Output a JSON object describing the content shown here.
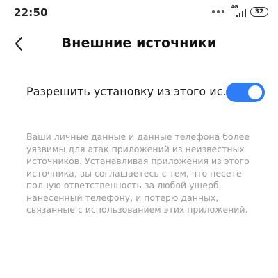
{
  "status_bar": {
    "time": "22:50",
    "network": "4G",
    "battery": "32"
  },
  "header": {
    "title": "Внешние источники"
  },
  "setting": {
    "label": "Разрешить установку из этого ис..",
    "enabled": true,
    "accent_color": "#2f7df6"
  },
  "description": {
    "text": "Ваши личные данные и данные телефона более уязвимы для атак приложений из неизвестных источников. Устанавливая приложения из этого источника, вы соглашаетесь с тем, что несете полную ответственность за любой ущерб, нанесенный телефону, и потерю данных, связанные с использованием этих приложений."
  },
  "icons": {
    "back": "chevron-left-icon",
    "signal": "signal-bars-icon",
    "battery": "battery-icon"
  }
}
